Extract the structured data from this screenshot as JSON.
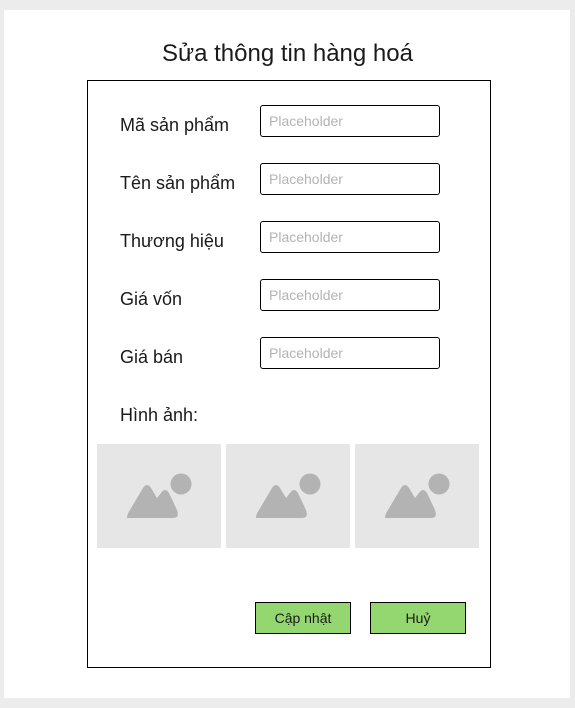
{
  "title": "Sửa thông tin hàng hoá",
  "fields": [
    {
      "label": "Mã sản phẩm",
      "placeholder": "Placeholder",
      "value": ""
    },
    {
      "label": "Tên sản phẩm",
      "placeholder": "Placeholder",
      "value": ""
    },
    {
      "label": "Thương hiệu",
      "placeholder": "Placeholder",
      "value": ""
    },
    {
      "label": "Giá vốn",
      "placeholder": "Placeholder",
      "value": ""
    },
    {
      "label": "Giá bán",
      "placeholder": "Placeholder",
      "value": ""
    }
  ],
  "images": {
    "label": "Hình ảnh:",
    "slots": [
      {
        "icon": "image-placeholder-icon"
      },
      {
        "icon": "image-placeholder-icon"
      },
      {
        "icon": "image-placeholder-icon"
      }
    ]
  },
  "buttons": {
    "update_label": "Cập nhật",
    "cancel_label": "Huỷ"
  },
  "colors": {
    "button_bg": "#94d66f",
    "placeholder_bg": "#e6e6e6",
    "placeholder_icon": "#b3b3b3"
  }
}
